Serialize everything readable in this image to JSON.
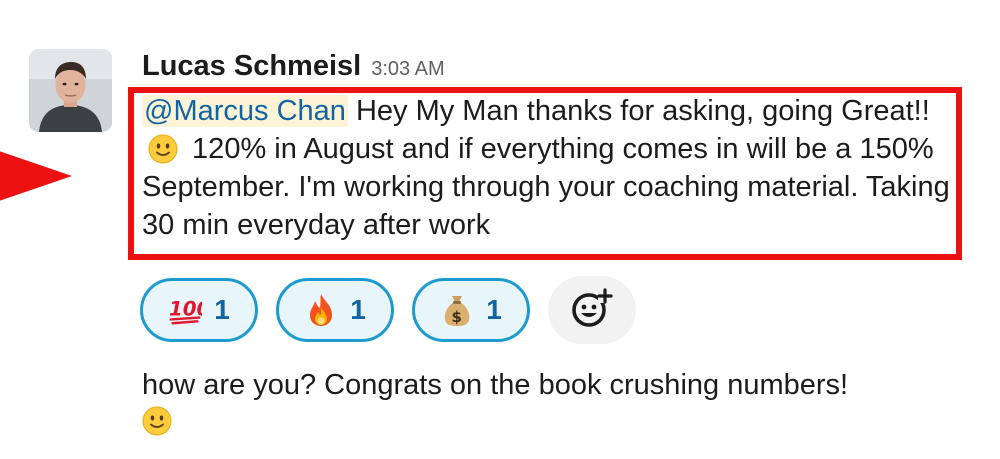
{
  "message": {
    "author": "Lucas Schmeisl",
    "timestamp": "3:03 AM",
    "mention": "@Marcus Chan",
    "text_part1": " Hey My Man thanks for asking, going Great!! ",
    "text_part2": " 120% in August and if everything comes in will be a 150% September. I'm working through your coaching material. Taking 30 min everyday after work",
    "inline_emoji": "slightly-smiling-face-icon"
  },
  "reactions": [
    {
      "emoji": "hundred-points-icon",
      "count": "1"
    },
    {
      "emoji": "fire-icon",
      "count": "1"
    },
    {
      "emoji": "money-bag-icon",
      "count": "1"
    }
  ],
  "add_reaction_icon": "add-reaction-icon",
  "followup": {
    "text": "how are you? Congrats on the book crushing numbers!",
    "emoji": "slightly-smiling-face-icon"
  },
  "colors": {
    "highlight": "#ee1111",
    "mention_text": "#1264a3",
    "mention_bg": "#fdf3d6",
    "reaction_border": "#1d9bd1",
    "reaction_bg": "#e8f5fa"
  }
}
